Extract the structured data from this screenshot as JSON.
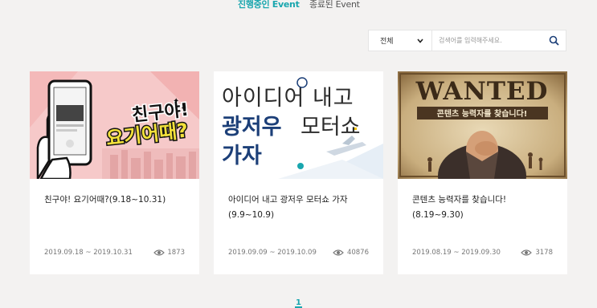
{
  "tabs": {
    "active": "진행중인 Event",
    "inactive": "종료된 Event"
  },
  "search": {
    "filter_label": "전체",
    "placeholder": "검색어를 입력해주세요."
  },
  "cards": [
    {
      "title": "친구야! 요기어때?(9.18~10.31)",
      "date_range": "2019.09.18  ~  2019.10.31",
      "views": "1873",
      "image_text": [
        "친구야!",
        "요기어때?"
      ]
    },
    {
      "title": "아이디어 내고 광저우 모터쇼 가자 (9.9~10.9)",
      "date_range": "2019.09.09  ~  2019.10.09",
      "views": "40876",
      "image_text": [
        "아이디어 내고",
        "광저우",
        "모터쇼",
        "가자"
      ]
    },
    {
      "title": "콘텐츠 능력자를 찾습니다! (8.19~9.30)",
      "date_range": "2019.08.19  ~  2019.09.30",
      "views": "3178",
      "image_text": [
        "WANTED",
        "콘텐츠 능력자를 찾습니다!"
      ]
    }
  ],
  "pagination": {
    "current": "1"
  },
  "colors": {
    "accent": "#19a6ae",
    "page_bg": "#f3f2f1"
  }
}
